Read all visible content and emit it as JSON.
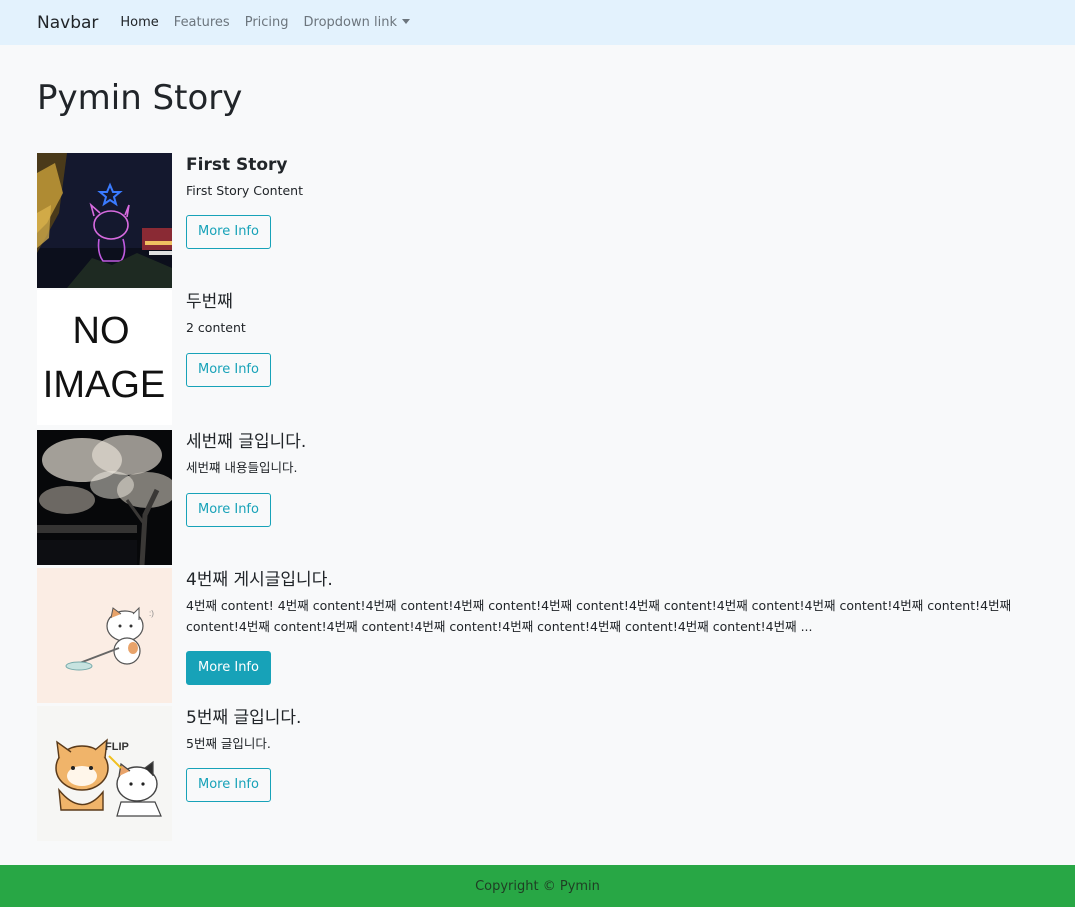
{
  "navbar": {
    "brand": "Navbar",
    "links": [
      {
        "label": "Home",
        "active": true
      },
      {
        "label": "Features",
        "active": false
      },
      {
        "label": "Pricing",
        "active": false
      },
      {
        "label": "Dropdown link",
        "active": false
      }
    ],
    "bg_color": "#e3f2fd"
  },
  "page": {
    "title": "Pymin Story"
  },
  "stories": [
    {
      "title": "First Story",
      "content": "First Story Content",
      "button": "More Info",
      "image": "hello-kitty-drone-show"
    },
    {
      "title": "두번째",
      "content": "2 content",
      "button": "More Info",
      "image": "no-image-placeholder",
      "image_text": [
        "NO",
        "IMAGE"
      ]
    },
    {
      "title": "세번째 글입니다.",
      "content": "세번쨰 내용들입니다.",
      "button": "More Info",
      "image": "cherry-blossom-night"
    },
    {
      "title": "4번째 게시글입니다.",
      "content": "4번째 content! 4번째 content!4번째 content!4번째 content!4번째 content!4번째 content!4번째 content!4번째 content!4번째 content!4번째 content!4번째 content!4번째 content!4번째 content!4번째 content!4번째 content!4번째 content!4번째 ...",
      "button": "More Info",
      "image": "cartoon-cat-cleaning"
    },
    {
      "title": "5번째 글입니다.",
      "content": "5번째 글입니다.",
      "button": "More Info",
      "image": "cartoon-dog-and-cat-flip",
      "image_text": [
        "FLIP"
      ]
    }
  ],
  "footer": {
    "text": "Copyright © Pymin",
    "bg_color": "#28a745"
  },
  "colors": {
    "button": "#17a2b8",
    "page_bg": "#f8f9fa"
  }
}
